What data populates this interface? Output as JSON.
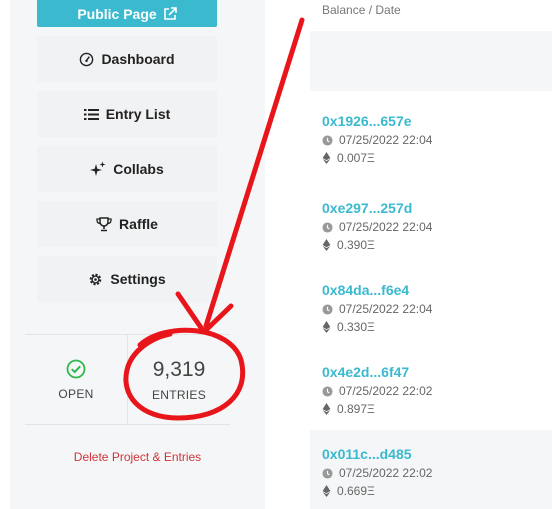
{
  "sidebar": {
    "public_page_label": "Public Page",
    "nav": [
      {
        "label": "Dashboard",
        "icon": "gauge-icon"
      },
      {
        "label": "Entry List",
        "icon": "list-icon"
      },
      {
        "label": "Collabs",
        "icon": "sparkles-icon"
      },
      {
        "label": "Raffle",
        "icon": "trophy-icon"
      },
      {
        "label": "Settings",
        "icon": "gear-icon"
      }
    ],
    "stats": {
      "open_label": "OPEN",
      "entries_count": "9,319",
      "entries_label": "ENTRIES"
    },
    "delete_label": "Delete Project & Entries"
  },
  "entries_table": {
    "column_header": "Balance / Date",
    "rows": [
      {
        "address": "0x1926...657e",
        "date": "07/25/2022 22:04",
        "balance": "0.007Ξ"
      },
      {
        "address": "0xe297...257d",
        "date": "07/25/2022 22:04",
        "balance": "0.390Ξ"
      },
      {
        "address": "0x84da...f6e4",
        "date": "07/25/2022 22:04",
        "balance": "0.330Ξ"
      },
      {
        "address": "0x4e2d...6f47",
        "date": "07/25/2022 22:02",
        "balance": "0.897Ξ"
      },
      {
        "address": "0x011c...d485",
        "date": "07/25/2022 22:02",
        "balance": "0.669Ξ"
      }
    ]
  },
  "colors": {
    "accent": "#3ab9cf",
    "danger": "#d0343a",
    "success": "#2db84c",
    "annotation": "#e8161b"
  }
}
